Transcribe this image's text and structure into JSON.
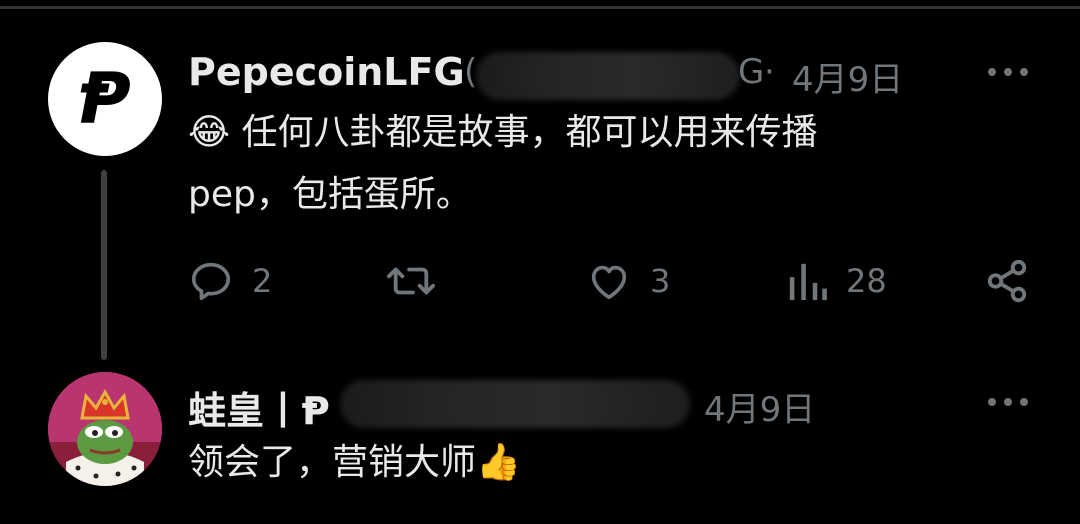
{
  "tweet1": {
    "author": "PepecoinLFG",
    "handle_prefix": "(",
    "handle_suffix": "G",
    "separator": "·",
    "date": "4月9日",
    "emoji": "😂",
    "text_line1": "任何八卦都是故事，都可以用来传播",
    "text_line2": "pep，包括蛋所。",
    "avatar_mark": "Ᵽ",
    "actions": {
      "replies": "2",
      "retweets": "",
      "likes": "3",
      "views": "28"
    }
  },
  "tweet2": {
    "author": "蛙皇丨Ᵽ",
    "date": "4月9日",
    "text": "领会了，营销大师",
    "emoji": "👍"
  },
  "colors": {
    "background": "#000000",
    "text": "#e7e9ea",
    "muted": "#71767b",
    "thread": "#3e4144"
  }
}
